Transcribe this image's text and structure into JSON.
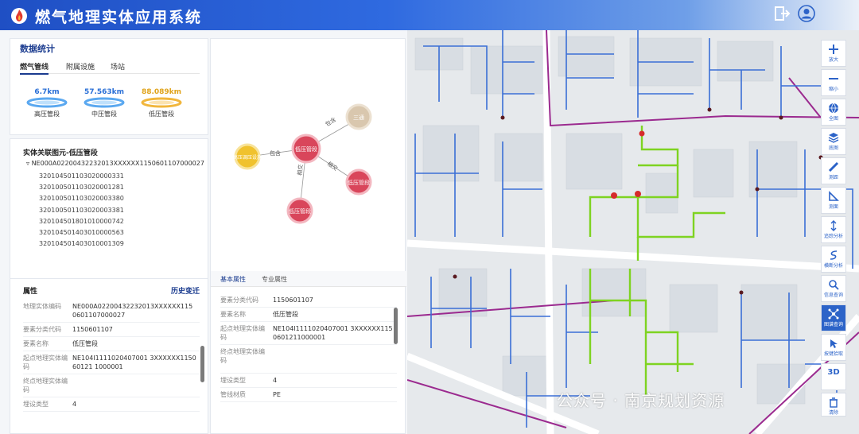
{
  "header": {
    "title": "燃气地理实体应用系统"
  },
  "stats": {
    "title": "数据统计",
    "tabs": [
      "燃气管线",
      "附属设施",
      "场站"
    ],
    "items": [
      {
        "value": "6.7km",
        "label": "高压管段",
        "color": "#2a6fd6"
      },
      {
        "value": "57.563km",
        "label": "中压管段",
        "color": "#2a6fd6"
      },
      {
        "value": "88.089km",
        "label": "低压管段",
        "color": "#e0a31a"
      }
    ]
  },
  "tree": {
    "title": "实体关联图元-低压管段",
    "root": "NE000A02200432232013XXXXXX1150601107000027",
    "children": [
      "320104501103020000331",
      "320100501103020001281",
      "320100501103020003380",
      "320100501103020003381",
      "320104501801010000742",
      "320104501403010000563",
      "320104501403010001309"
    ]
  },
  "attr": {
    "title": "属性",
    "history": "历史变迁",
    "rows": [
      {
        "k": "地理实体编码",
        "v": "NE000A02200432232013XXXXXX1150601107000027"
      },
      {
        "k": "要素分类代码",
        "v": "1150601107"
      },
      {
        "k": "要素名称",
        "v": "低压管段"
      },
      {
        "k": "起点地理实体编码",
        "v": "NE104I1111020407001 3XXXXXX115060121 1000001"
      },
      {
        "k": "终点地理实体编码",
        "v": ""
      },
      {
        "k": "埋设类型",
        "v": "4"
      }
    ]
  },
  "graph": {
    "center": "低压管段",
    "nodes": [
      {
        "id": "left",
        "label": "高压调压设施",
        "color": "#f0c22e"
      },
      {
        "id": "top",
        "label": "三通",
        "color": "#d9c7ae"
      },
      {
        "id": "right",
        "label": "低压管段",
        "color": "#d9465b"
      },
      {
        "id": "bottom",
        "label": "低压管段",
        "color": "#d9465b"
      }
    ],
    "edges": [
      "包含",
      "包含",
      "相交",
      "相交"
    ]
  },
  "detail": {
    "tabs": [
      "基本属性",
      "专业属性"
    ],
    "rows": [
      {
        "k": "要素分类代码",
        "v": "1150601107"
      },
      {
        "k": "要素名称",
        "v": "低压管段"
      },
      {
        "k": "起点地理实体编码",
        "v": "NE104I1111020407001 3XXXXXX1150601211000001"
      },
      {
        "k": "终点地理实体编码",
        "v": ""
      },
      {
        "k": "埋设类型",
        "v": "4"
      },
      {
        "k": "管线材质",
        "v": "PE"
      }
    ]
  },
  "toolbar": [
    {
      "label": "放大",
      "icon": "plus-icon"
    },
    {
      "label": "缩小",
      "icon": "minus-icon"
    },
    {
      "label": "全图",
      "icon": "globe-icon"
    },
    {
      "label": "底图",
      "icon": "layers-icon"
    },
    {
      "label": "测距",
      "icon": "ruler-icon"
    },
    {
      "label": "测面",
      "icon": "area-icon"
    },
    {
      "label": "追踪分析",
      "icon": "trace-icon"
    },
    {
      "label": "横断分析",
      "icon": "section-icon"
    },
    {
      "label": "信息查询",
      "icon": "search-icon"
    },
    {
      "label": "图谱查询",
      "icon": "graph-icon"
    },
    {
      "label": "按键拾取",
      "icon": "pick-icon"
    },
    {
      "label": "3D",
      "icon": "3d-icon"
    },
    {
      "label": "清除",
      "icon": "clear-icon"
    }
  ],
  "watermark": "公众号 · 南京规划资源"
}
